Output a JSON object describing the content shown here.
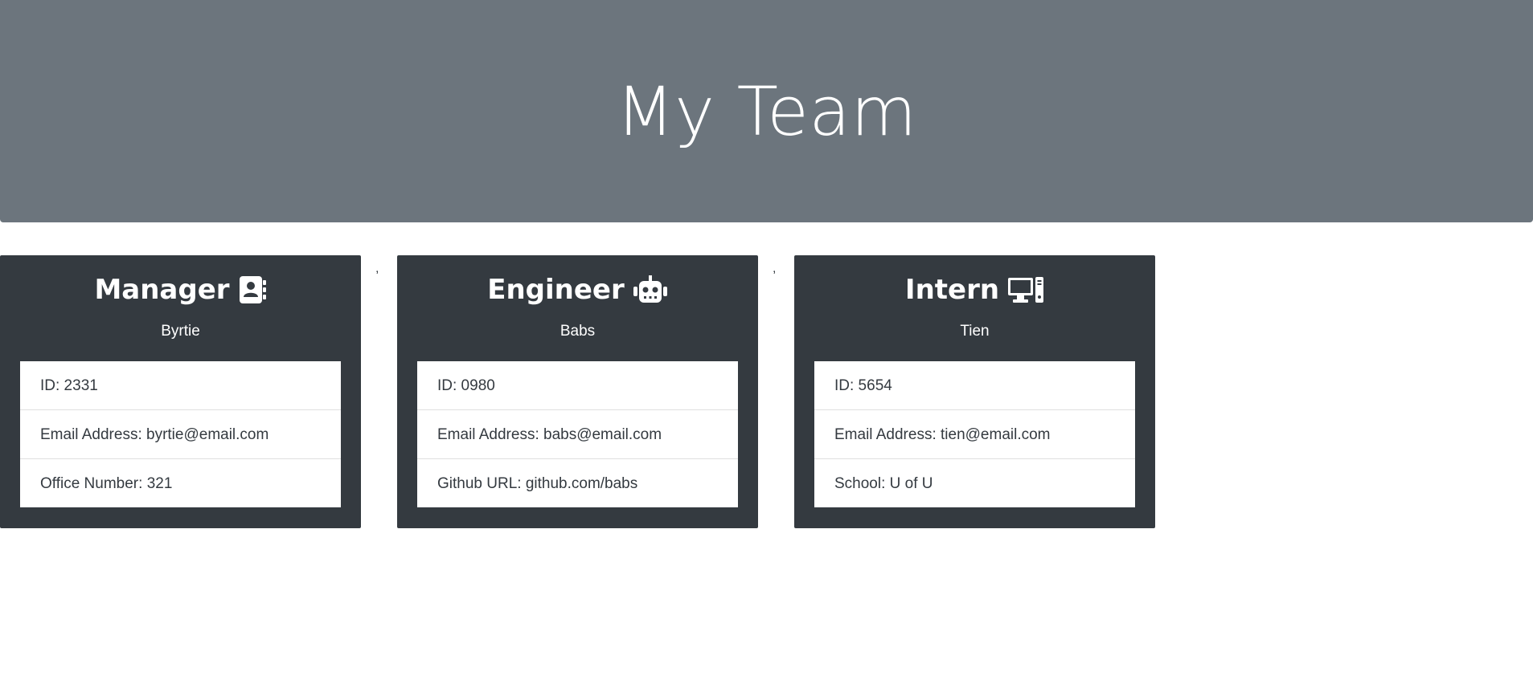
{
  "header": {
    "title": "My Team"
  },
  "separator": ",",
  "colors": {
    "jumbotron": "#6c757d",
    "card": "#343a40",
    "text_light": "#ffffff"
  },
  "cards": [
    {
      "role": "Manager",
      "icon": "address-book-icon",
      "name": "Byrtie",
      "items": [
        "ID: 2331",
        "Email Address: byrtie@email.com",
        "Office Number: 321"
      ]
    },
    {
      "role": "Engineer",
      "icon": "robot-icon",
      "name": "Babs",
      "items": [
        "ID: 0980",
        "Email Address: babs@email.com",
        "Github URL: github.com/babs"
      ]
    },
    {
      "role": "Intern",
      "icon": "computer-icon",
      "name": "Tien",
      "items": [
        "ID: 5654",
        "Email Address: tien@email.com",
        "School: U of U"
      ]
    }
  ]
}
